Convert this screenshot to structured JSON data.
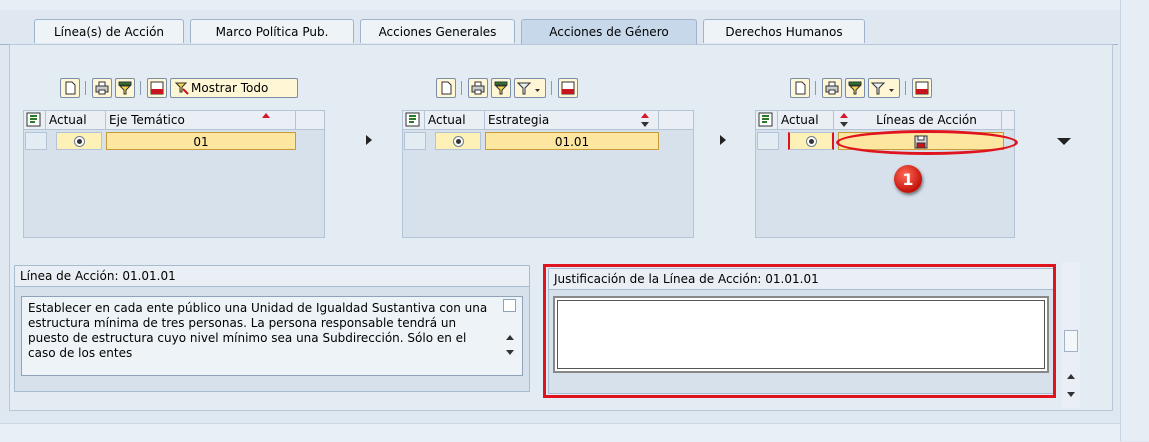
{
  "tabs": [
    {
      "label": "Línea(s) de Acción",
      "active": false
    },
    {
      "label": "Marco Política Pub.",
      "active": false
    },
    {
      "label": "Acciones Generales",
      "active": false
    },
    {
      "label": "Acciones de Género",
      "active": true
    },
    {
      "label": "Derechos Humanos",
      "active": false
    }
  ],
  "toolbar1": {
    "show_all_label": "Mostrar Todo"
  },
  "table1": {
    "col_actual": "Actual",
    "col_main": "Eje Temático",
    "row_value": "01"
  },
  "table2": {
    "col_actual": "Actual",
    "col_main": "Estrategia",
    "row_value": "01.01"
  },
  "table3": {
    "col_actual": "Actual",
    "col_main": "Líneas de Acción"
  },
  "badge": {
    "number": "1"
  },
  "linea_box": {
    "title": "Línea de Acción: 01.01.01",
    "text": "Establecer en cada ente público una Unidad de Igualdad Sustantiva con una estructura mínima de tres personas. La persona responsable tendrá un puesto de estructura cuyo nivel mínimo sea una Subdirección. Sólo en el caso de los entes"
  },
  "justif_box": {
    "title": "Justificación de la Línea de Acción: 01.01.01",
    "text": ""
  },
  "colors": {
    "highlight_red": "#e0141e",
    "selected_cell": "#fce6a0",
    "panel_bg": "#d6e1ec"
  },
  "icons": [
    "new-document-icon",
    "print-icon",
    "filter-icon",
    "filter-dropdown-icon",
    "export-icon",
    "show-all-icon",
    "select-all-icon",
    "save-icon"
  ]
}
